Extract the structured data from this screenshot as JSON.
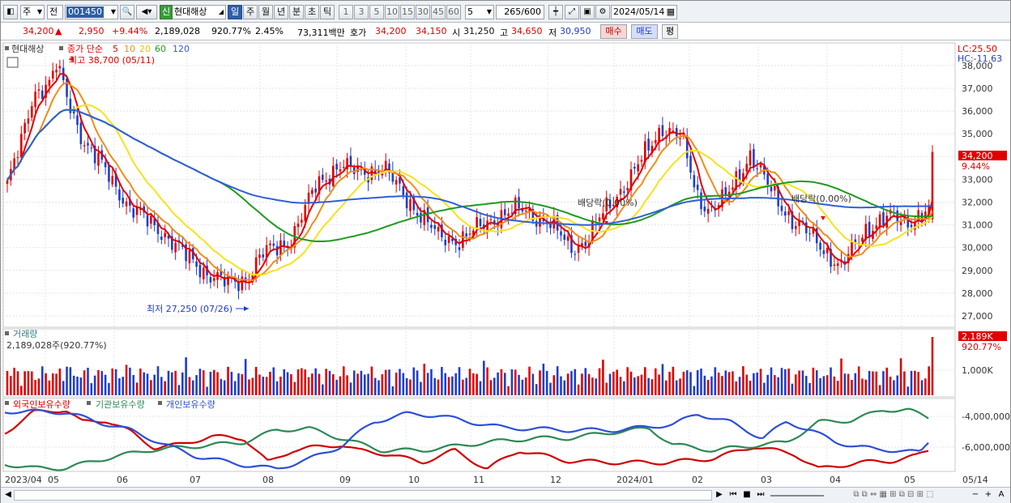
{
  "toolbar": {
    "mode": "주",
    "market_prefix": "전",
    "code": "001450",
    "credit_badge": "신",
    "stock_name": "현대해상",
    "periods": [
      "일",
      "주",
      "월",
      "년",
      "분",
      "초",
      "틱"
    ],
    "active_period": "일",
    "minute_steps": [
      "1",
      "3",
      "5",
      "10",
      "15",
      "30",
      "45",
      "60"
    ],
    "step_value": "5",
    "count_value": "265",
    "count_max": "/600",
    "date": "2024/05/14"
  },
  "quote": {
    "price": "34,200",
    "arrow": "▲",
    "change": "2,950",
    "change_pct": "+9.44%",
    "volume": "2,189,028",
    "volume_ratio": "920.77%",
    "turnover": "2.45%",
    "amount": "73,311백만",
    "ask_label": "호가",
    "ask": "34,200",
    "bid": "34,150",
    "open_label": "시",
    "open": "31,250",
    "high_label": "고",
    "high": "34,650",
    "low_label": "저",
    "low": "30,950",
    "buy_button": "매수",
    "sell_button": "매도",
    "eval_button": "평"
  },
  "price_panel": {
    "stock_label": "현대해상",
    "ma_prefix": "종가 단순",
    "ma_periods": [
      "5",
      "10",
      "20",
      "60",
      "120"
    ],
    "lc_label": "LC:25.50",
    "hc_label": "HC:-11.63",
    "high_annotation": "최고 38,700 (05/11)",
    "low_annotation": "최저 27,250 (07/26)",
    "dividend_annotation": "배당락(0.00%)",
    "current_tag": "34,200",
    "current_pct_tag": "9.44%",
    "y_ticks": [
      "38,000",
      "37,000",
      "36,000",
      "35,000",
      "34,000",
      "33,000",
      "32,000",
      "31,000",
      "30,000",
      "29,000",
      "28,000",
      "27,000"
    ]
  },
  "volume_panel": {
    "title": "거래량",
    "value_text": "2,189,028주(920.77%)",
    "tag_value": "2,189K",
    "tag_pct": "920.77%",
    "y_ticks": [
      "1,000K"
    ]
  },
  "holdings_panel": {
    "legend": [
      "외국인보유수량",
      "기관보유수량",
      "개인보유수량"
    ],
    "y_ticks": [
      "-4,000,000",
      "-6,000,000"
    ]
  },
  "x_axis": [
    "2023/04",
    "05",
    "06",
    "07",
    "08",
    "09",
    "10",
    "11",
    "12",
    "2024/01",
    "02",
    "03",
    "04",
    "05",
    "05/14"
  ],
  "colors": {
    "up": "#e00000",
    "down": "#1f3ec9",
    "ma5": "#e00000",
    "ma10": "#f08c1a",
    "ma20": "#f5e31c",
    "ma60": "#1f9a1f",
    "ma120": "#2f5fd6",
    "foreign": "#d00000",
    "institution": "#2c8a55",
    "individual": "#2d4fd8"
  }
}
